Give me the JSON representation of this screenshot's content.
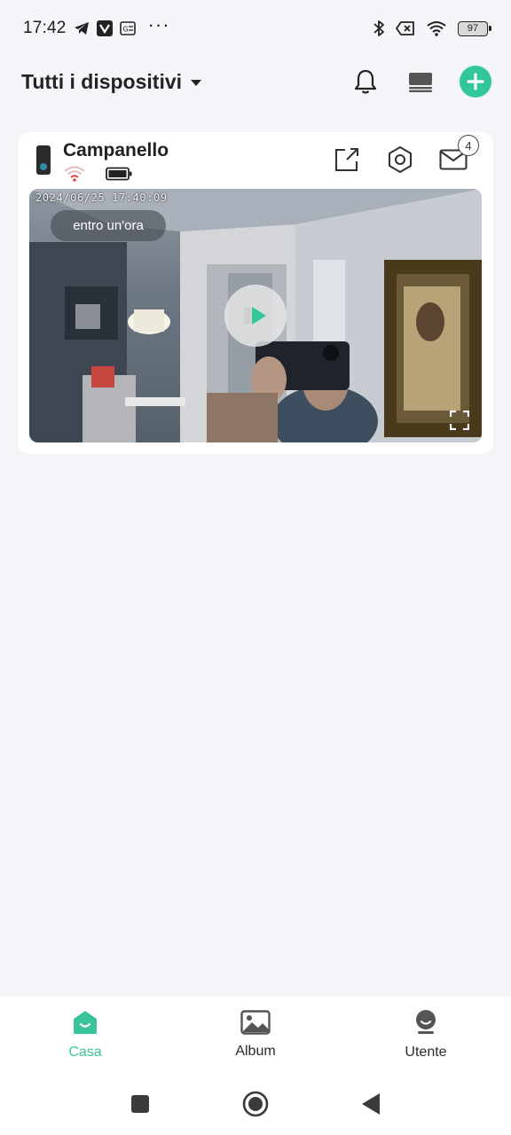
{
  "status_bar": {
    "time": "17:42",
    "icons": [
      "telegram-icon",
      "vivaldi-icon",
      "translate-icon",
      "more-dots-icon",
      "bluetooth-icon",
      "sim-disabled-icon",
      "wifi-icon"
    ],
    "more": "···",
    "battery": "97"
  },
  "header": {
    "title": "Tutti i dispositivi",
    "actions": [
      "bell-icon",
      "multiview-icon",
      "add-icon"
    ]
  },
  "device_card": {
    "name": "Campanello",
    "wifi_status_color": "#e34444",
    "timestamp": "2024/06/25  17:40:09",
    "time_pill": "entro un'ora",
    "message_count": "4",
    "actions": [
      "share-icon",
      "settings-icon",
      "messages-icon"
    ]
  },
  "bottom_nav": {
    "items": [
      {
        "label": "Casa",
        "icon": "home-icon",
        "active": true
      },
      {
        "label": "Album",
        "icon": "album-icon",
        "active": false
      },
      {
        "label": "Utente",
        "icon": "user-icon",
        "active": false
      }
    ]
  },
  "colors": {
    "accent": "#3bc39a",
    "background": "#f4f5f8",
    "card": "#ffffff"
  }
}
